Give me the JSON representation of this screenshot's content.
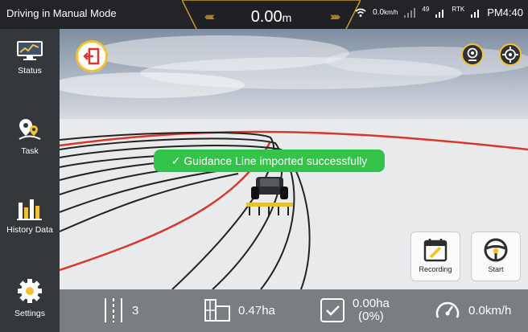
{
  "topbar": {
    "mode": "Driving in Manual Mode",
    "distance": "0.00",
    "distance_unit": "m",
    "speed_small": "0.0",
    "speed_small_unit": "km/h",
    "signal_num": "49",
    "rtk": "RTK",
    "time": "PM4:40"
  },
  "sidebar": {
    "items": [
      {
        "label": "Status",
        "icon": "monitor-chart-icon"
      },
      {
        "label": "Task",
        "icon": "map-pin-route-icon"
      },
      {
        "label": "History Data",
        "icon": "bar-chart-icon"
      },
      {
        "label": "Settings",
        "icon": "gear-icon"
      }
    ]
  },
  "scene": {
    "toast": "✓  Guidance Line imported successfully"
  },
  "actions": {
    "recording": "Recording",
    "start": "Start"
  },
  "bottombar": {
    "rows": "3",
    "area": "0.47ha",
    "worked_area": "0.00ha",
    "worked_percent": "(0%)",
    "speed": "0.0km/h"
  },
  "colors": {
    "accent": "#f2c233",
    "success": "#33c24a",
    "guide_red": "#d8372d",
    "sidebar": "#34373c"
  }
}
